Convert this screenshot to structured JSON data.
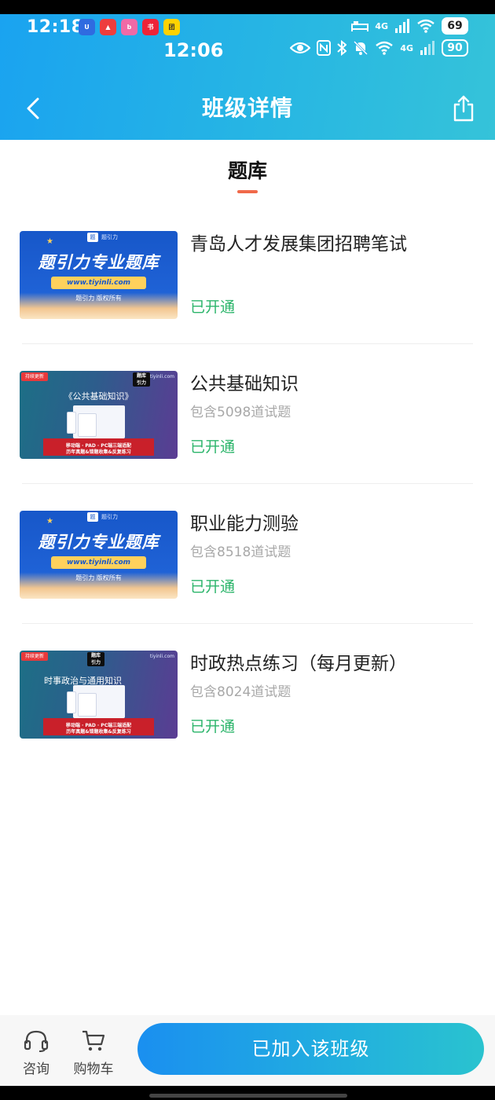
{
  "status_bar": {
    "time": "12:18",
    "battery": "69",
    "secondary_time": "12:06",
    "secondary_battery": "90",
    "network_label": "4G",
    "app_icons": [
      {
        "icon": "shield-app-icon",
        "color": "#2f6be0"
      },
      {
        "icon": "a-app-icon",
        "color": "#ee3d3d"
      },
      {
        "icon": "bilibili-app-icon",
        "color": "#f06aa6"
      },
      {
        "icon": "xiaohongshu-app-icon",
        "color": "#ee2438"
      },
      {
        "icon": "meituan-app-icon",
        "color": "#ffd200"
      }
    ]
  },
  "header": {
    "title": "班级详情",
    "back_icon": "chevron-left-icon",
    "share_icon": "share-icon",
    "gradient": [
      "#1aa3f0",
      "#35c3d9"
    ]
  },
  "section_tab": {
    "label": "题库",
    "underline_color": "#f0694a"
  },
  "thumbnails": {
    "a": {
      "brand": "题引力",
      "title": "题引力专业题库",
      "url": "www.tiyinli.com",
      "subtitle": "题引力 版权所有"
    },
    "b1": {
      "badge": "持续更新",
      "brand_line1": "题库",
      "brand_line2": "引力",
      "url": "tiyinli.com",
      "title": "《公共基础知识》",
      "line1": "移动端 · PAD · PC端三端适配",
      "line2": "历年真题&错题收集&反复练习"
    },
    "b2": {
      "badge": "持续更新",
      "brand_line1": "题库",
      "brand_line2": "引力",
      "url": "tiyinli.com",
      "title": "时事政治与通用知识",
      "line1": "移动端 · PAD · PC端三端适配",
      "line2": "历年真题&错题收集&反复练习"
    }
  },
  "items": [
    {
      "title": "青岛人才发展集团招聘笔试",
      "count": "",
      "status": "已开通"
    },
    {
      "title": "公共基础知识",
      "count": "包含5098道试题",
      "status": "已开通"
    },
    {
      "title": "职业能力测验",
      "count": "包含8518道试题",
      "status": "已开通"
    },
    {
      "title": "时政热点练习（每月更新）",
      "count": "包含8024道试题",
      "status": "已开通"
    }
  ],
  "status_color": "#2cb56b",
  "bottom_bar": {
    "consult_label": "咨询",
    "consult_icon": "headset-icon",
    "cart_label": "购物车",
    "cart_icon": "shopping-cart-icon",
    "join_label": "已加入该班级"
  }
}
